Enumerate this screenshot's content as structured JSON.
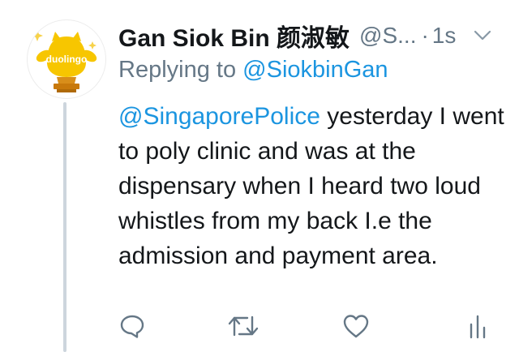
{
  "tweet": {
    "display_name": "Gan Siok Bin 颜淑敏",
    "handle": "@S...",
    "dot": "·",
    "time": "1s",
    "replying_prefix": "Replying to",
    "replying_handle": "@SiokbinGan",
    "mention": "@SingaporePolice",
    "text_after_mention": " yesterday I went to poly clinic and was at the dispensary when I heard two loud whistles from my back I.e the admission and payment area."
  },
  "avatar": {
    "logo_text": "duolingo",
    "mascot_color": "#f7c600",
    "trophy_color": "#c8790b",
    "logo_text_color": "#ffffff"
  },
  "icons": {
    "menu": "chevron-down-icon",
    "reply": "comment-icon",
    "retweet": "retweet-icon",
    "like": "heart-icon",
    "analytics": "analytics-icon"
  },
  "colors": {
    "text": "#14171a",
    "secondary": "#657786",
    "link": "#1b95e0",
    "thread_line": "#cdd5dd"
  }
}
